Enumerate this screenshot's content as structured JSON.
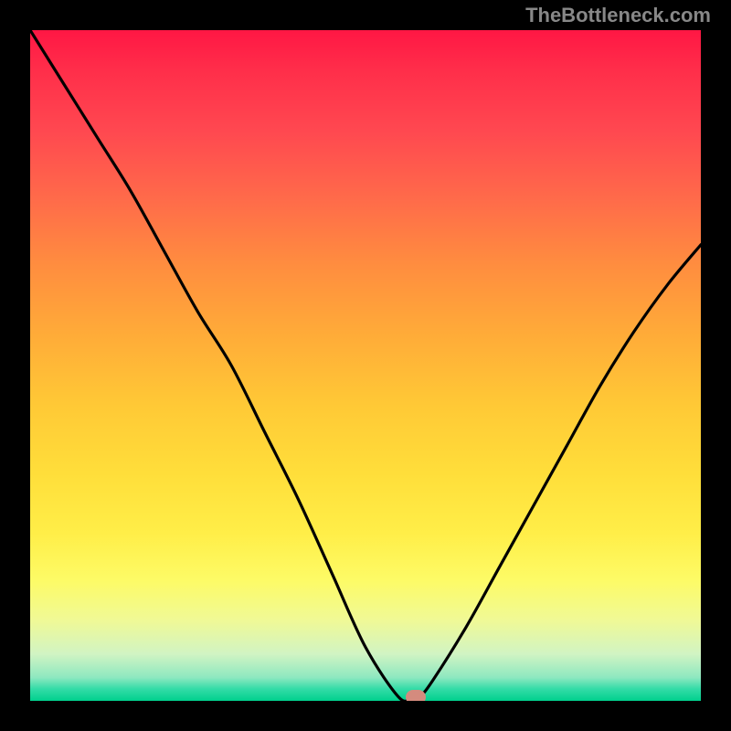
{
  "watermark": "TheBottleneck.com",
  "chart_data": {
    "type": "line",
    "title": "",
    "xlabel": "",
    "ylabel": "",
    "x": [
      0.0,
      0.05,
      0.1,
      0.15,
      0.2,
      0.25,
      0.3,
      0.35,
      0.4,
      0.45,
      0.5,
      0.55,
      0.57,
      0.58,
      0.6,
      0.65,
      0.7,
      0.75,
      0.8,
      0.85,
      0.9,
      0.95,
      1.0
    ],
    "values": [
      1.0,
      0.92,
      0.84,
      0.76,
      0.67,
      0.58,
      0.5,
      0.4,
      0.3,
      0.19,
      0.08,
      0.005,
      0.005,
      0.005,
      0.03,
      0.11,
      0.2,
      0.29,
      0.38,
      0.47,
      0.55,
      0.62,
      0.68
    ],
    "xlim": [
      0,
      1
    ],
    "ylim": [
      0,
      1
    ],
    "marker": {
      "x": 0.575,
      "y": 0.005,
      "color": "#d48b7e"
    },
    "background": "rainbow-vertical-gradient",
    "colors": {
      "top": "#ff1744",
      "mid": "#ffde3a",
      "bottom": "#00d08d"
    }
  }
}
